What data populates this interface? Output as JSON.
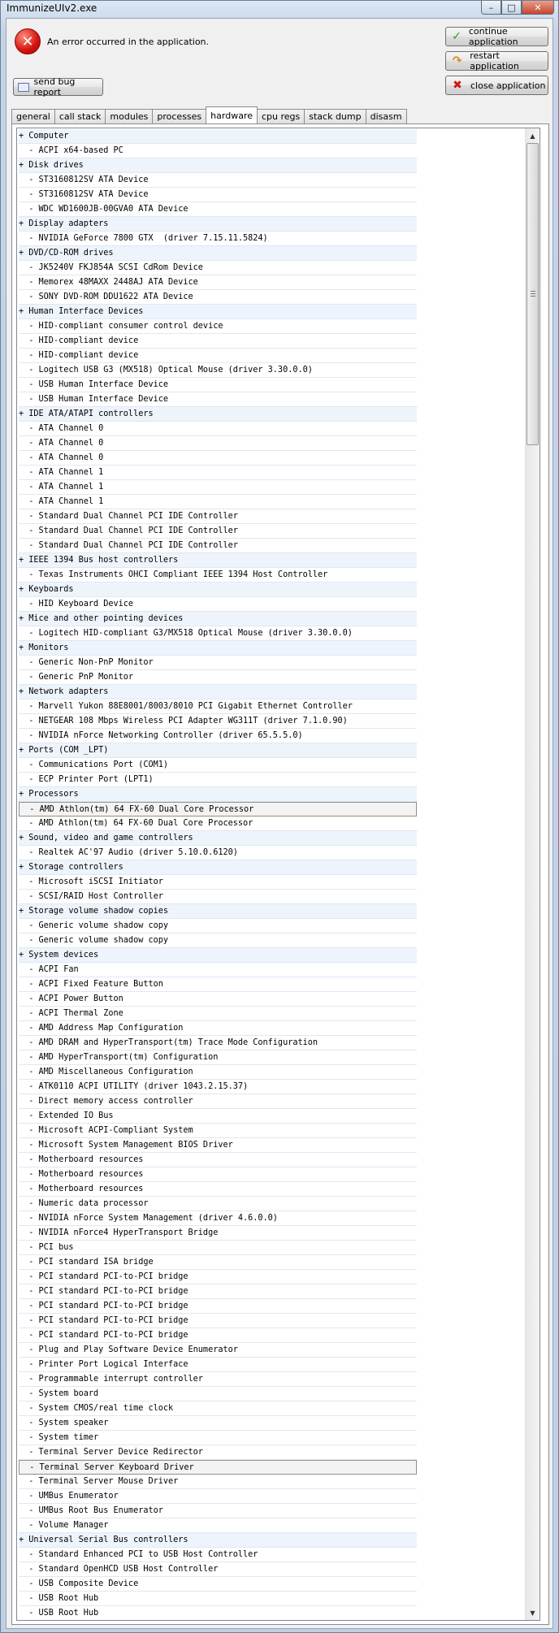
{
  "window": {
    "title": "ImmunizeUIv2.exe"
  },
  "message": {
    "text": "An error occurred in the application."
  },
  "actions": {
    "continue": "continue application",
    "restart": "restart application",
    "close": "close application",
    "bug_report": "send bug report"
  },
  "tabs": [
    {
      "label": "general",
      "active": false
    },
    {
      "label": "call stack",
      "active": false
    },
    {
      "label": "modules",
      "active": false
    },
    {
      "label": "processes",
      "active": false
    },
    {
      "label": "hardware",
      "active": true
    },
    {
      "label": "cpu regs",
      "active": false
    },
    {
      "label": "stack dump",
      "active": false
    },
    {
      "label": "disasm",
      "active": false
    }
  ],
  "hardware": {
    "rows": [
      {
        "t": "+ Computer",
        "cat": true
      },
      {
        "t": "  - ACPI x64-based PC"
      },
      {
        "t": "+ Disk drives",
        "cat": true
      },
      {
        "t": "  - ST3160812SV ATA Device"
      },
      {
        "t": "  - ST3160812SV ATA Device"
      },
      {
        "t": "  - WDC WD1600JB-00GVA0 ATA Device"
      },
      {
        "t": "+ Display adapters",
        "cat": true
      },
      {
        "t": "  - NVIDIA GeForce 7800 GTX  (driver 7.15.11.5824)"
      },
      {
        "t": "+ DVD/CD-ROM drives",
        "cat": true
      },
      {
        "t": "  - JK5240V FKJ854A SCSI CdRom Device"
      },
      {
        "t": "  - Memorex 48MAXX 2448AJ ATA Device"
      },
      {
        "t": "  - SONY DVD-ROM DDU1622 ATA Device"
      },
      {
        "t": "+ Human Interface Devices",
        "cat": true
      },
      {
        "t": "  - HID-compliant consumer control device"
      },
      {
        "t": "  - HID-compliant device"
      },
      {
        "t": "  - HID-compliant device"
      },
      {
        "t": "  - Logitech USB G3 (MX518) Optical Mouse (driver 3.30.0.0)"
      },
      {
        "t": "  - USB Human Interface Device"
      },
      {
        "t": "  - USB Human Interface Device"
      },
      {
        "t": "+ IDE ATA/ATAPI controllers",
        "cat": true
      },
      {
        "t": "  - ATA Channel 0"
      },
      {
        "t": "  - ATA Channel 0"
      },
      {
        "t": "  - ATA Channel 0"
      },
      {
        "t": "  - ATA Channel 1"
      },
      {
        "t": "  - ATA Channel 1"
      },
      {
        "t": "  - ATA Channel 1"
      },
      {
        "t": "  - Standard Dual Channel PCI IDE Controller"
      },
      {
        "t": "  - Standard Dual Channel PCI IDE Controller"
      },
      {
        "t": "  - Standard Dual Channel PCI IDE Controller"
      },
      {
        "t": "+ IEEE 1394 Bus host controllers",
        "cat": true
      },
      {
        "t": "  - Texas Instruments OHCI Compliant IEEE 1394 Host Controller"
      },
      {
        "t": "+ Keyboards",
        "cat": true
      },
      {
        "t": "  - HID Keyboard Device"
      },
      {
        "t": "+ Mice and other pointing devices",
        "cat": true
      },
      {
        "t": "  - Logitech HID-compliant G3/MX518 Optical Mouse (driver 3.30.0.0)"
      },
      {
        "t": "+ Monitors",
        "cat": true
      },
      {
        "t": "  - Generic Non-PnP Monitor"
      },
      {
        "t": "  - Generic PnP Monitor"
      },
      {
        "t": "+ Network adapters",
        "cat": true
      },
      {
        "t": "  - Marvell Yukon 88E8001/8003/8010 PCI Gigabit Ethernet Controller"
      },
      {
        "t": "  - NETGEAR 108 Mbps Wireless PCI Adapter WG311T (driver 7.1.0.90)"
      },
      {
        "t": "  - NVIDIA nForce Networking Controller (driver 65.5.5.0)"
      },
      {
        "t": "+ Ports (COM _LPT)",
        "cat": true
      },
      {
        "t": "  - Communications Port (COM1)"
      },
      {
        "t": "  - ECP Printer Port (LPT1)"
      },
      {
        "t": "+ Processors",
        "cat": true
      },
      {
        "t": "  - AMD Athlon(tm) 64 FX-60 Dual Core Processor",
        "sel": true
      },
      {
        "t": "  - AMD Athlon(tm) 64 FX-60 Dual Core Processor"
      },
      {
        "t": "+ Sound, video and game controllers",
        "cat": true
      },
      {
        "t": "  - Realtek AC'97 Audio (driver 5.10.0.6120)"
      },
      {
        "t": "+ Storage controllers",
        "cat": true
      },
      {
        "t": "  - Microsoft iSCSI Initiator"
      },
      {
        "t": "  - SCSI/RAID Host Controller"
      },
      {
        "t": "+ Storage volume shadow copies",
        "cat": true
      },
      {
        "t": "  - Generic volume shadow copy"
      },
      {
        "t": "  - Generic volume shadow copy"
      },
      {
        "t": "+ System devices",
        "cat": true
      },
      {
        "t": "  - ACPI Fan"
      },
      {
        "t": "  - ACPI Fixed Feature Button"
      },
      {
        "t": "  - ACPI Power Button"
      },
      {
        "t": "  - ACPI Thermal Zone"
      },
      {
        "t": "  - AMD Address Map Configuration"
      },
      {
        "t": "  - AMD DRAM and HyperTransport(tm) Trace Mode Configuration"
      },
      {
        "t": "  - AMD HyperTransport(tm) Configuration"
      },
      {
        "t": "  - AMD Miscellaneous Configuration"
      },
      {
        "t": "  - ATK0110 ACPI UTILITY (driver 1043.2.15.37)"
      },
      {
        "t": "  - Direct memory access controller"
      },
      {
        "t": "  - Extended IO Bus"
      },
      {
        "t": "  - Microsoft ACPI-Compliant System"
      },
      {
        "t": "  - Microsoft System Management BIOS Driver"
      },
      {
        "t": "  - Motherboard resources"
      },
      {
        "t": "  - Motherboard resources"
      },
      {
        "t": "  - Motherboard resources"
      },
      {
        "t": "  - Numeric data processor"
      },
      {
        "t": "  - NVIDIA nForce System Management (driver 4.6.0.0)"
      },
      {
        "t": "  - NVIDIA nForce4 HyperTransport Bridge"
      },
      {
        "t": "  - PCI bus"
      },
      {
        "t": "  - PCI standard ISA bridge"
      },
      {
        "t": "  - PCI standard PCI-to-PCI bridge"
      },
      {
        "t": "  - PCI standard PCI-to-PCI bridge"
      },
      {
        "t": "  - PCI standard PCI-to-PCI bridge"
      },
      {
        "t": "  - PCI standard PCI-to-PCI bridge"
      },
      {
        "t": "  - PCI standard PCI-to-PCI bridge"
      },
      {
        "t": "  - Plug and Play Software Device Enumerator"
      },
      {
        "t": "  - Printer Port Logical Interface"
      },
      {
        "t": "  - Programmable interrupt controller"
      },
      {
        "t": "  - System board"
      },
      {
        "t": "  - System CMOS/real time clock"
      },
      {
        "t": "  - System speaker"
      },
      {
        "t": "  - System timer"
      },
      {
        "t": "  - Terminal Server Device Redirector"
      },
      {
        "t": "  - Terminal Server Keyboard Driver",
        "sel": true
      },
      {
        "t": "  - Terminal Server Mouse Driver"
      },
      {
        "t": "  - UMBus Enumerator"
      },
      {
        "t": "  - UMBus Root Bus Enumerator"
      },
      {
        "t": "  - Volume Manager"
      },
      {
        "t": "+ Universal Serial Bus controllers",
        "cat": true
      },
      {
        "t": "  - Standard Enhanced PCI to USB Host Controller"
      },
      {
        "t": "  - Standard OpenHCD USB Host Controller"
      },
      {
        "t": "  - USB Composite Device"
      },
      {
        "t": "  - USB Root Hub"
      },
      {
        "t": "  - USB Root Hub"
      }
    ]
  }
}
